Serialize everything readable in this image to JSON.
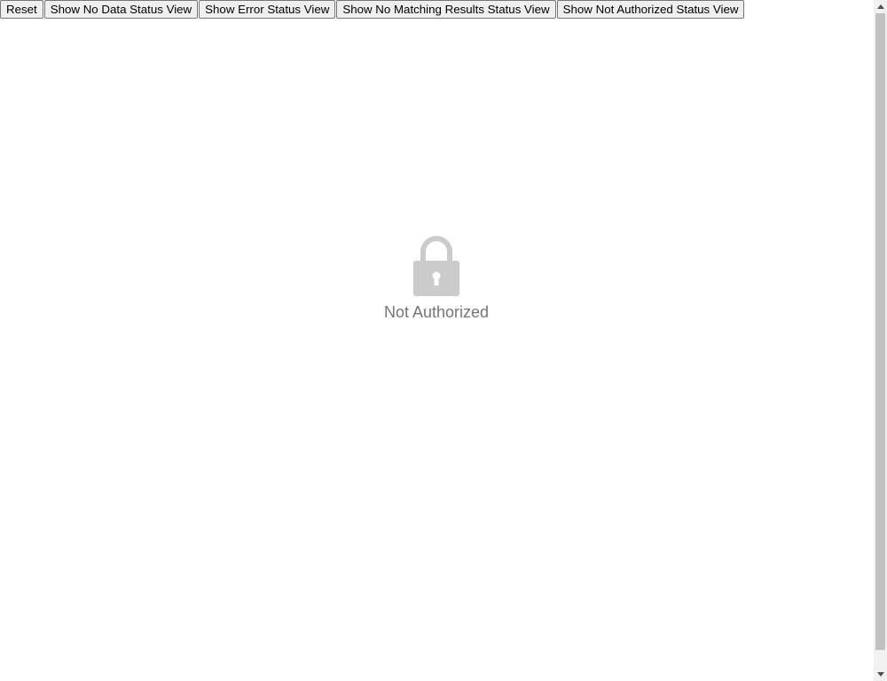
{
  "toolbar": {
    "buttons": [
      {
        "label": "Reset"
      },
      {
        "label": "Show No Data Status View"
      },
      {
        "label": "Show Error Status View"
      },
      {
        "label": "Show No Matching Results Status View"
      },
      {
        "label": "Show Not Authorized Status View"
      }
    ]
  },
  "status_view": {
    "icon": "lock-icon",
    "label": "Not Authorized"
  },
  "colors": {
    "icon": "#cbcbcb",
    "label": "#767676",
    "scrollbar_track": "#f1f1f1",
    "scrollbar_thumb": "#c1c1c1"
  }
}
